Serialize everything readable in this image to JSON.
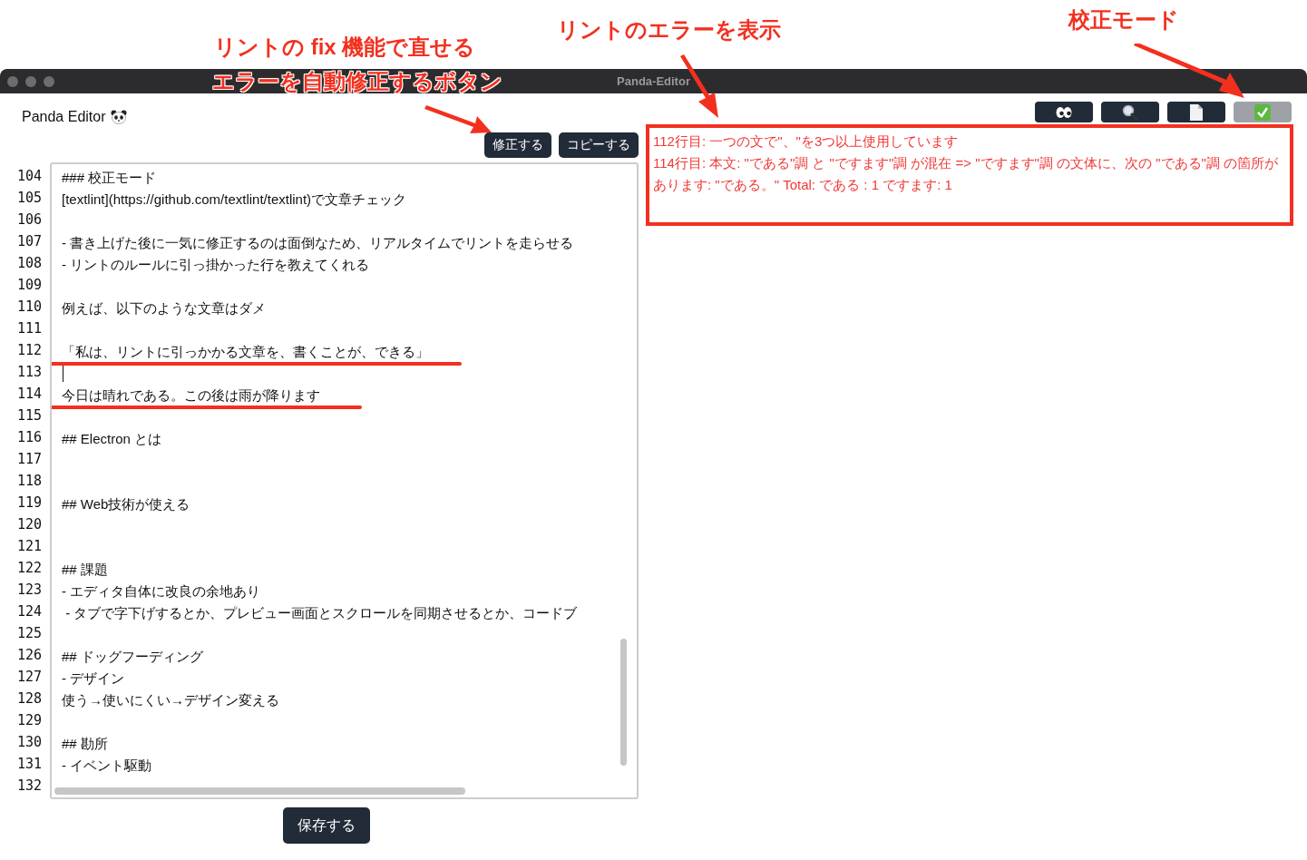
{
  "annotations": {
    "fix_note": [
      "リントの fix 機能で直せる",
      "エラーを自動修正するボタン"
    ],
    "errors_note": "リントのエラーを表示",
    "mode_note": "校正モード"
  },
  "window": {
    "title": "Panda-Editor"
  },
  "app_title": "Panda Editor",
  "editor_buttons": [
    "修正する",
    "コピーする"
  ],
  "editor": {
    "lines": [
      {
        "number": "104",
        "text": "### 校正モード"
      },
      {
        "number": "105",
        "text": "[textlint](https://github.com/textlint/textlint)で文章チェック"
      },
      {
        "number": "106"
      },
      {
        "number": "107",
        "text": "- 書き上げた後に一気に修正するのは面倒なため、リアルタイムでリントを走らせる"
      },
      {
        "number": "108",
        "text": "- リントのルールに引っ掛かった行を教えてくれる"
      },
      {
        "number": "109"
      },
      {
        "number": "110",
        "text": "例えば、以下のような文章はダメ"
      },
      {
        "number": "111"
      },
      {
        "number": "112",
        "text": "「私は、リントに引っかかる文章を、書くことが、できる」",
        "marked": true
      },
      {
        "number": "113",
        "cursor": true
      },
      {
        "number": "114",
        "text": "今日は晴れである。この後は雨が降ります",
        "marked": true
      },
      {
        "number": "115"
      },
      {
        "number": "116",
        "text": "## Electron とは"
      },
      {
        "number": "117"
      },
      {
        "number": "118"
      },
      {
        "number": "119",
        "text": "## Web技術が使える"
      },
      {
        "number": "120"
      },
      {
        "number": "121"
      },
      {
        "number": "122",
        "text": "## 課題"
      },
      {
        "number": "123",
        "text": "- エディタ自体に改良の余地あり"
      },
      {
        "number": "124",
        "text": " - タブで字下げするとか、プレビュー画面とスクロールを同期させるとか、コードブ"
      },
      {
        "number": "125"
      },
      {
        "number": "126",
        "text": "## ドッグフーディング"
      },
      {
        "number": "127",
        "text": "- デザイン"
      },
      {
        "number": "128",
        "text": "使う→使いにくい→デザイン変える"
      },
      {
        "number": "129"
      },
      {
        "number": "130",
        "text": "## 勘所"
      },
      {
        "number": "131",
        "text": "- イベント駆動"
      },
      {
        "number": "132"
      }
    ]
  },
  "save_button": "保存する",
  "toolbar": [
    {
      "kind": "eyes",
      "active": false
    },
    {
      "kind": "search",
      "active": false
    },
    {
      "kind": "document",
      "active": false
    },
    {
      "kind": "check",
      "active": true
    }
  ],
  "lint_errors": [
    "112行目: 一つの文で\"、\"を3つ以上使用しています",
    "114行目: 本文: \"である\"調 と \"ですます\"調 が混在 => \"ですます\"調 の文体に、次の \"である\"調 の箇所があります: \"である。\" Total: である : 1 ですます: 1"
  ]
}
